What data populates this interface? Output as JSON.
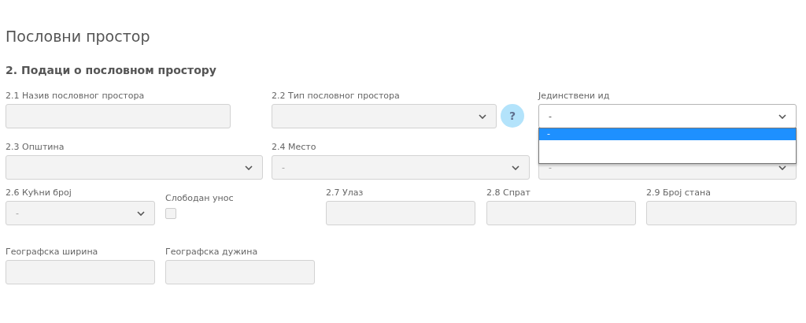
{
  "page_title": "Пословни простор",
  "section_heading": "2. Подаци о пословном простору",
  "rows": [
    [
      {
        "kind": "text",
        "label": "2.1 Назив пословног простора",
        "disabled": true
      },
      {
        "kind": "select",
        "label": "2.2 Тип пословног простора",
        "disabled": true
      },
      {
        "kind": "help",
        "label": "?"
      },
      {
        "kind": "select",
        "label": "Јединствени ид",
        "value": "-",
        "disabled": false,
        "open": true,
        "options": [
          {
            "label": "-",
            "selected": true
          }
        ]
      }
    ],
    [
      {
        "kind": "select",
        "label": "2.3 Општина",
        "disabled": true
      },
      {
        "kind": "select",
        "label": "2.4 Место",
        "value": "-",
        "disabled": true
      },
      {
        "kind": "select",
        "value": "-",
        "disabled": true
      }
    ],
    [
      {
        "kind": "select",
        "label": "2.6 Кућни број",
        "value": "-",
        "disabled": true
      },
      {
        "kind": "checkbox",
        "label": "Слободан унос",
        "checked": false,
        "disabled": true
      },
      {
        "kind": "text",
        "label": "2.7 Улаз",
        "disabled": true
      },
      {
        "kind": "text",
        "label": "2.8 Спрат",
        "disabled": true
      },
      {
        "kind": "text",
        "label": "2.9 Број стана",
        "disabled": true
      }
    ],
    [
      {
        "kind": "text",
        "label": "Географска ширина",
        "disabled": true
      },
      {
        "kind": "text",
        "label": "Географска дужина",
        "disabled": true
      }
    ]
  ]
}
